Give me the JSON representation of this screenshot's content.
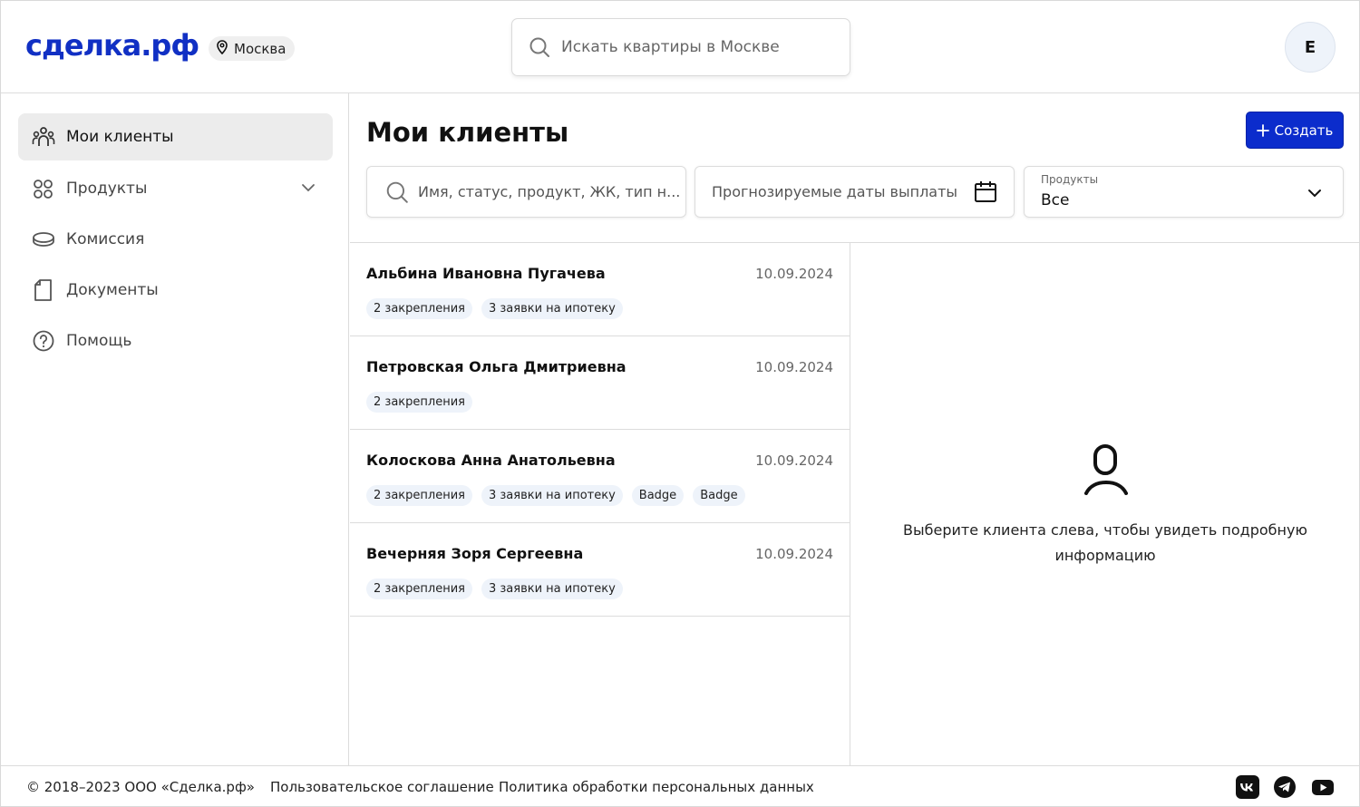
{
  "header": {
    "logo": "сделка.рф",
    "city": "Москва",
    "search_placeholder": "Искать квартиры в Москве",
    "avatar_initial": "Е"
  },
  "sidebar": {
    "items": [
      {
        "label": "Мои клиенты",
        "icon": "users-icon",
        "active": true
      },
      {
        "label": "Продукты",
        "icon": "grid-icon",
        "expandable": true
      },
      {
        "label": "Комиссия",
        "icon": "coin-icon"
      },
      {
        "label": "Документы",
        "icon": "document-icon"
      },
      {
        "label": "Помощь",
        "icon": "help-icon"
      }
    ]
  },
  "main": {
    "title": "Мои клиенты",
    "create_label": "Создать",
    "filters": {
      "search_placeholder": "Имя, статус, продукт, ЖК, тип н...",
      "dates_placeholder": "Прогнозируемые даты выплаты",
      "products_label": "Продукты",
      "products_value": "Все"
    }
  },
  "clients": [
    {
      "name": "Альбина Ивановна Пугачева",
      "date": "10.09.2024",
      "tags": [
        "2 закрепления",
        "3 заявки на ипотеку"
      ]
    },
    {
      "name": "Петровская Ольга Дмитриевна",
      "date": "10.09.2024",
      "tags": [
        "2 закрепления"
      ]
    },
    {
      "name": "Колоскова Анна Анатольевна",
      "date": "10.09.2024",
      "tags": [
        "2 закрепления",
        "3 заявки на ипотеку",
        "Badge",
        "Badge"
      ]
    },
    {
      "name": "Вечерняя Зоря Сергеевна",
      "date": "10.09.2024",
      "tags": [
        "2 закрепления",
        "3 заявки на ипотеку"
      ]
    }
  ],
  "detail": {
    "empty_line1": "Выберите клиента слева, чтобы увидеть подробную",
    "empty_line2": "информацию"
  },
  "footer": {
    "copyright": "© 2018–2023 ООО «Сделка.рф»",
    "agreement": "Пользовательское соглашение",
    "privacy": "Политика обработки персональных данных",
    "social": [
      "vk-icon",
      "telegram-icon",
      "youtube-icon"
    ]
  },
  "colors": {
    "brand": "#0b2ccc",
    "badge_bg": "#eef3fa"
  }
}
